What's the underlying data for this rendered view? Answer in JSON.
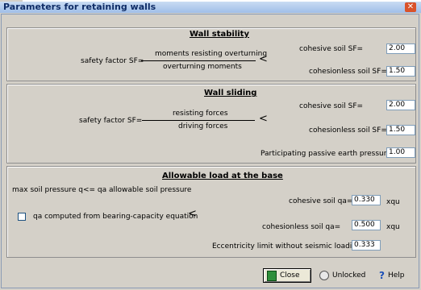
{
  "window": {
    "title": "Parameters for retaining walls"
  },
  "wall_stability": {
    "heading": "Wall stability",
    "sf_label": "safety factor SF=",
    "numerator": "moments resisting overturning",
    "denominator": "overturning moments",
    "cohesive_label": "cohesive soil SF=",
    "cohesive_value": "2.00",
    "cohesionless_label": "cohesionless soil SF=",
    "cohesionless_value": "1.50"
  },
  "wall_sliding": {
    "heading": "Wall sliding",
    "sf_label": "safety factor SF=",
    "numerator": "resisting forces",
    "denominator": "driving forces",
    "cohesive_label": "cohesive soil SF=",
    "cohesive_value": "2.00",
    "cohesionless_label": "cohesionless soil SF=",
    "cohesionless_value": "1.50",
    "passive_label": "Participating passive earth pressure",
    "passive_value": "1.00"
  },
  "allowable_load": {
    "heading": "Allowable load at the base",
    "max_label": "max soil pressure q<= qa allowable soil pressure",
    "checkbox_label": "qa computed from bearing-capacity equation",
    "cohesive_label": "cohesive soil qa=",
    "cohesive_value": "0.330",
    "cohesive_unit": "xqu",
    "cohesionless_label": "cohesionless soil qa=",
    "cohesionless_value": "0.500",
    "cohesionless_unit": "xqu",
    "ecc_label": "Eccentricity limit without seismic loading",
    "ecc_value": "0.333"
  },
  "buttons": {
    "close": "Close",
    "unlocked": "Unlocked",
    "help": "Help"
  },
  "icons": {
    "close_window": "x-icon",
    "door": "door-exit-icon",
    "lock": "lock-icon",
    "help": "help-icon",
    "arrow": "arrow-icon"
  }
}
